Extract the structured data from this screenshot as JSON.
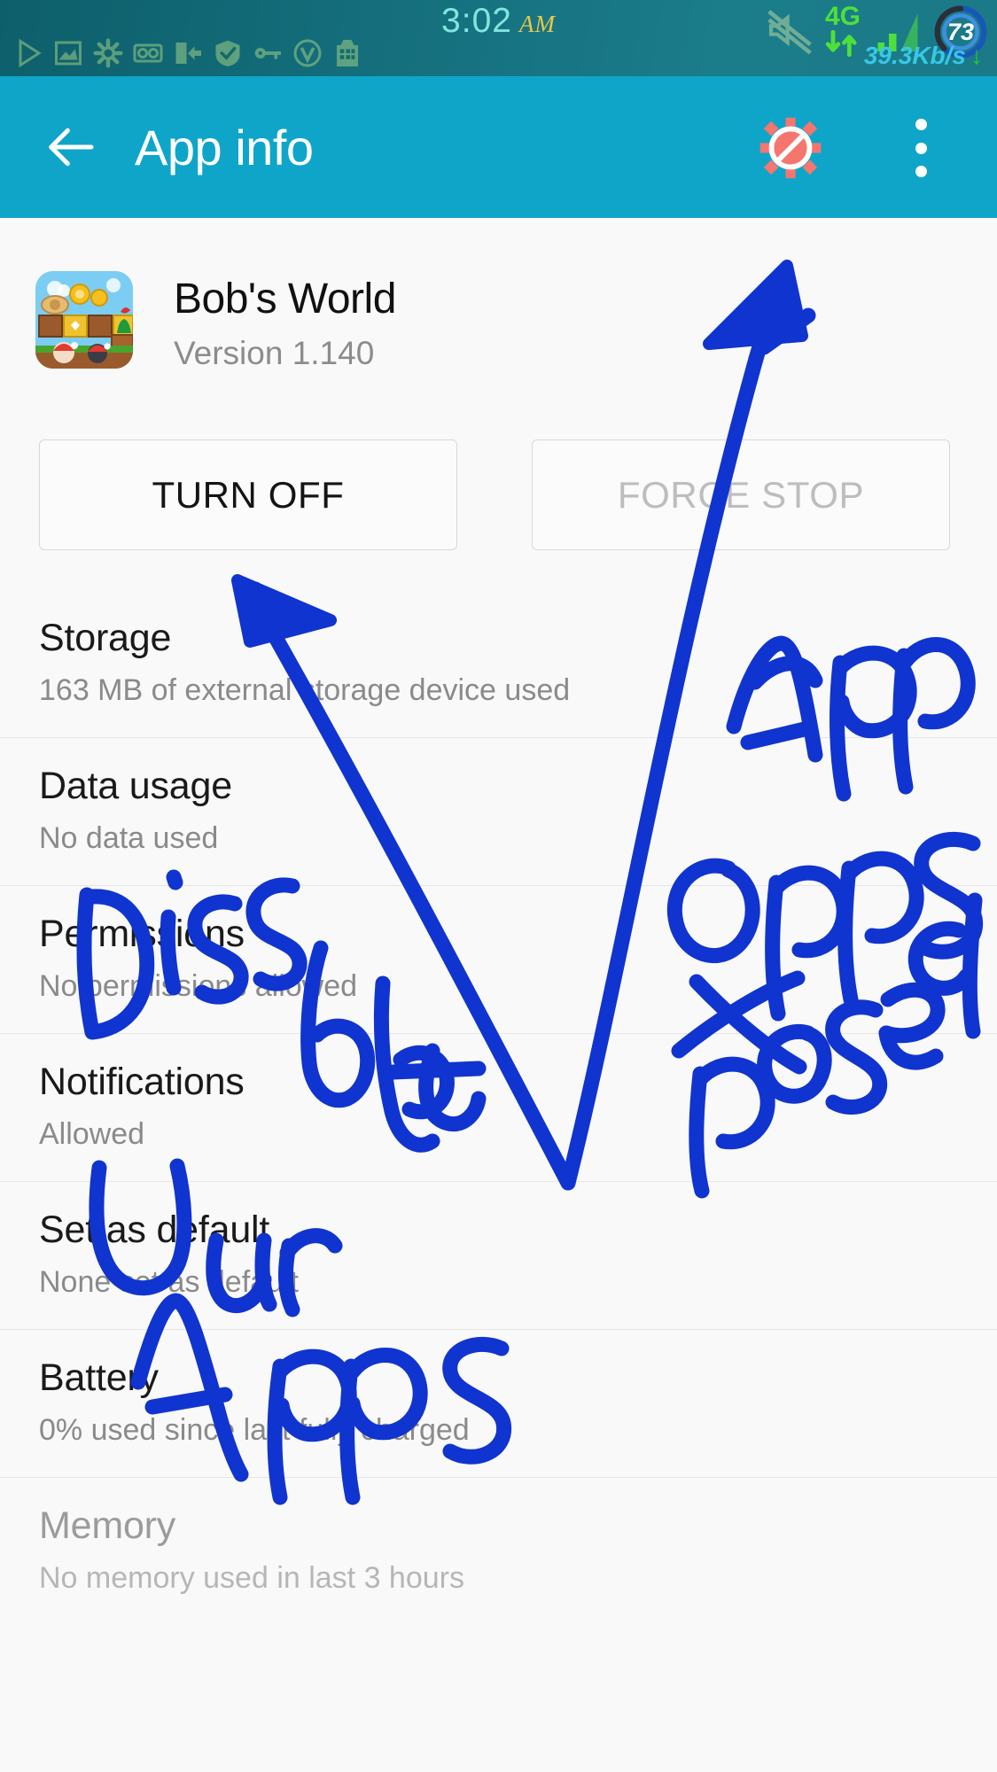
{
  "statusbar": {
    "time": "3:02",
    "ampm": "AM",
    "network_type": "4G",
    "battery_percent": "73",
    "data_speed": "39.3Kb/s",
    "speed_direction_icon": "download-arrow-icon",
    "notification_icons": [
      "play-icon",
      "image-icon",
      "gear-icon",
      "voicemail-icon",
      "app-update-icon",
      "shield-check-icon",
      "key-icon",
      "v-circle-icon",
      "package-icon"
    ],
    "mute_icon": "mute-icon",
    "signal_icon": "signal-bars-icon"
  },
  "appbar": {
    "back_icon": "back-arrow-icon",
    "title": "App info",
    "disable_icon": "disable-gear-icon",
    "overflow_icon": "overflow-menu-icon"
  },
  "app": {
    "icon": "bobs-world-app-icon",
    "name": "Bob's World",
    "version": "Version 1.140"
  },
  "buttons": {
    "turn_off": "TURN OFF",
    "force_stop": "FORCE STOP"
  },
  "rows": [
    {
      "title": "Storage",
      "subtitle": "163 MB of external storage device used",
      "dim": false
    },
    {
      "title": "Data usage",
      "subtitle": "No data used",
      "dim": false
    },
    {
      "title": "Permissions",
      "subtitle": "No permissions allowed",
      "dim": false
    },
    {
      "title": "Notifications",
      "subtitle": "Allowed",
      "dim": false
    },
    {
      "title": "Set as default",
      "subtitle": "None set as default",
      "dim": false
    },
    {
      "title": "Battery",
      "subtitle": "0% used since last fully charged",
      "dim": false
    },
    {
      "title": "Memory",
      "subtitle": "No memory used in last 3 hours",
      "dim": true
    }
  ],
  "annotations": {
    "color": "#1034cf",
    "notes": [
      {
        "text": "Dissable",
        "name": "annotation-dissable"
      },
      {
        "text": "User",
        "name": "annotation-user"
      },
      {
        "text": "Apps",
        "name": "annotation-apps"
      },
      {
        "text": "App",
        "name": "annotation-app"
      },
      {
        "text": "opps",
        "name": "annotation-opps"
      },
      {
        "text": "Xposed",
        "name": "annotation-xposed"
      }
    ],
    "arrows": [
      {
        "name": "annotation-arrow-to-storage"
      },
      {
        "name": "annotation-arrow-to-force-stop"
      }
    ]
  },
  "colors": {
    "statusbar": "#15707e",
    "appbar_accent": "#0fa5c9",
    "content_bg": "#f9f9f9",
    "title_text": "#1a1a1a",
    "subtitle_text": "#8a8a8a",
    "annotation_blue": "#1034cf"
  }
}
